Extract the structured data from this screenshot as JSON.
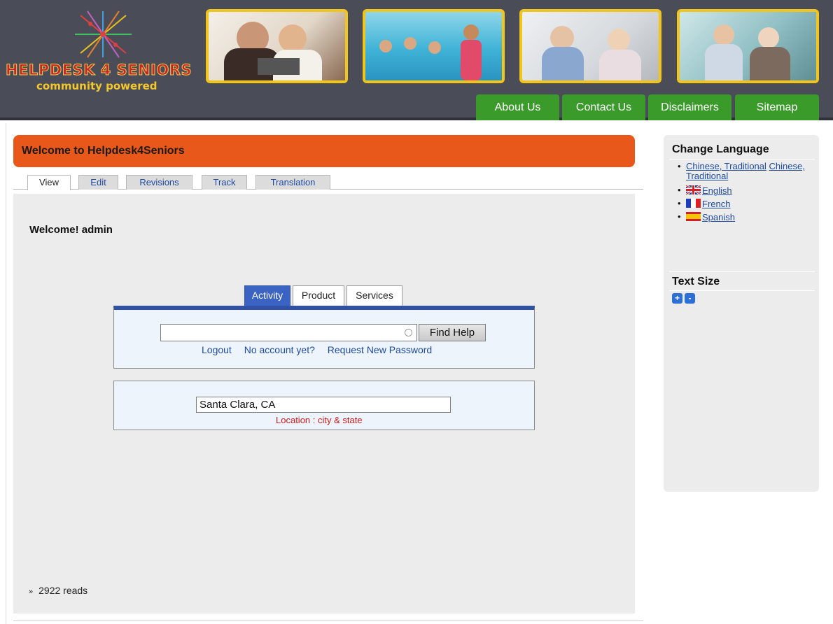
{
  "header": {
    "logo_title": "HELPDESK 4 SENIORS",
    "logo_subtitle": "community powered",
    "photos": [
      "photo-couple-laptop",
      "photo-water-aerobics",
      "photo-seniors-celebrating",
      "photo-senior-assistance"
    ]
  },
  "nav": {
    "items": [
      "About Us",
      "Contact Us",
      "Disclaimers",
      "Sitemap"
    ],
    "color": "#3a9b2a"
  },
  "page": {
    "title": "Welcome to Helpdesk4Seniors",
    "title_color": "#e8581a",
    "tabs": [
      "View",
      "Edit",
      "Revisions",
      "Track",
      "Translation"
    ],
    "active_tab": "View",
    "welcome_text": "Welcome! admin"
  },
  "search": {
    "tabs": [
      "Activity",
      "Product",
      "Services"
    ],
    "active_tab": "Activity",
    "query": "",
    "button_label": "Find Help",
    "links": [
      "Logout",
      "No account yet?",
      "Request New Password"
    ],
    "accent_color": "#2f52a8"
  },
  "location": {
    "value": "Santa Clara, CA",
    "hint": "Location : city & state"
  },
  "footer": {
    "reads": "2922 reads"
  },
  "sidebar": {
    "language_heading": "Change Language",
    "languages": [
      {
        "label": "Chinese, Traditional",
        "label2": "Chinese, Traditional",
        "flag": ""
      },
      {
        "label": "English",
        "flag": "uk-flag"
      },
      {
        "label": "French",
        "flag": "france-flag"
      },
      {
        "label": "Spanish",
        "flag": "spain-flag"
      }
    ],
    "textsize_heading": "Text Size",
    "textsize_buttons": [
      "+",
      "-"
    ]
  }
}
